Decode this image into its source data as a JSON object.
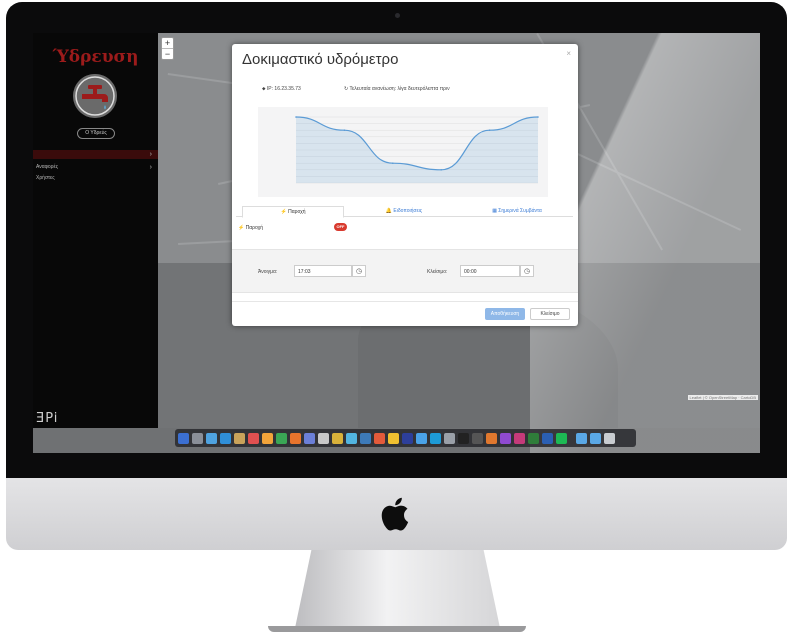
{
  "sidebar": {
    "brand": "Ύδρευση",
    "user_button": "Ο Υδρεύς",
    "items": [
      {
        "label": ""
      },
      {
        "label": "Αναφορές"
      },
      {
        "label": "Χρήστες"
      }
    ],
    "footer_logo": "ƎPi"
  },
  "map": {
    "zoom_in": "+",
    "zoom_out": "−",
    "attribution": "Leaflet | © OpenStreetMap · CartoDB"
  },
  "modal": {
    "title": "Δοκιμαστικό υδρόμετρο",
    "close": "×",
    "ip": "IP: 16.23.35.73",
    "last_update": "Τελευταία ανανέωση: λίγα δευτερόλεπτα πριν",
    "tabs": [
      {
        "label": "⚡ Παροχή"
      },
      {
        "label": "🔔 Ειδοποιήσεις"
      },
      {
        "label": "▦ Σημερινά Συμβάντα"
      }
    ],
    "flow_label": "⚡ Παροχή",
    "toggle": "OFF",
    "open_label": "Άνοιγμα:",
    "open_value": "17:03",
    "close_label": "Κλείσιμο:",
    "close_value": "00:00",
    "save_button": "Αποθήκευση",
    "close_button": "Κλείσιμο"
  },
  "chart_data": {
    "type": "area",
    "series": [
      {
        "values": [
          1000,
          800,
          300,
          200,
          800,
          1000
        ]
      }
    ],
    "ylim": [
      0,
      1000
    ],
    "color": "#5b9bd5"
  },
  "colors": {
    "brand": "#9c1b1b",
    "sidebar_bg": "#080808",
    "toggle_off": "#d83a2e",
    "primary": "#8fb8e8"
  }
}
